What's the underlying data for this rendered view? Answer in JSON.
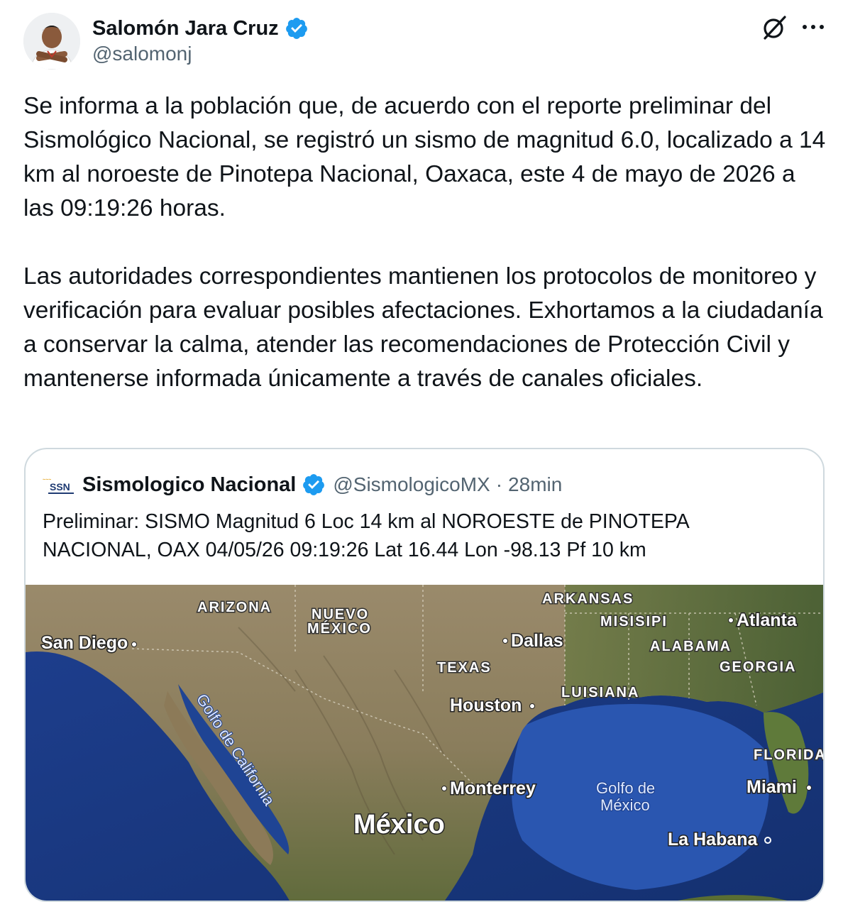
{
  "author": {
    "name": "Salomón Jara Cruz",
    "handle": "@salomonj",
    "verified_color": "#1d9bf0",
    "avatar_icon": "profile-photo"
  },
  "actions": {
    "grok_icon": "grok-slash-icon",
    "more_icon": "more-dots-icon"
  },
  "tweet": {
    "paragraph_1": "Se informa a la población que, de acuerdo con el reporte preliminar del Sismológico Nacional, se registró un sismo de magnitud 6.0, localizado a 14 km al noroeste de Pinotepa Nacional, Oaxaca, este 4 de mayo de 2026 a las 09:19:26 horas.",
    "paragraph_2": "Las autoridades correspondientes mantienen los protocolos de monitoreo y verificación para evaluar posibles afectaciones. Exhortamos a la ciudadanía a conservar la calma, atender las recomendaciones de Protección Civil y mantenerse informada únicamente a través de canales oficiales."
  },
  "quote": {
    "logo_text": "SSN",
    "name": "Sismologico Nacional",
    "handle": "@SismologicoMX",
    "separator": "·",
    "time": "28min",
    "text": "Preliminar: SISMO Magnitud 6 Loc  14 km al NOROESTE de PINOTEPA\nNACIONAL, OAX 04/05/26 09:19:26 Lat 16.44 Lon -98.13 Pf 10 km"
  },
  "map": {
    "states": [
      "ARIZONA",
      "NUEVO",
      "MÉXICO",
      "ARKANSAS",
      "MISISIPI",
      "ALABAMA",
      "TEXAS",
      "GEORGIA",
      "LUISIANA",
      "FLORIDA"
    ],
    "cities": [
      "San Diego",
      "Dallas",
      "Atlanta",
      "Houston",
      "Monterrey",
      "Miami",
      "La Habana"
    ],
    "water": [
      "Golfo de California",
      "Golfo de",
      "México"
    ],
    "country": "México"
  }
}
